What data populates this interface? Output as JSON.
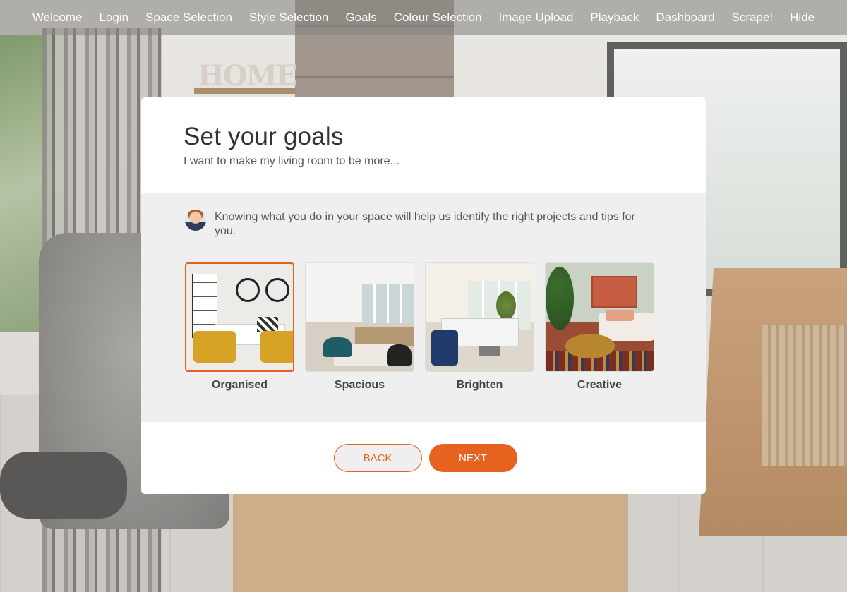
{
  "nav": {
    "items": [
      {
        "label": "Welcome"
      },
      {
        "label": "Login"
      },
      {
        "label": "Space Selection"
      },
      {
        "label": "Style Selection"
      },
      {
        "label": "Goals"
      },
      {
        "label": "Colour Selection"
      },
      {
        "label": "Image Upload"
      },
      {
        "label": "Playback"
      },
      {
        "label": "Dashboard"
      },
      {
        "label": "Scrape!"
      },
      {
        "label": "Hide"
      }
    ]
  },
  "modal": {
    "title": "Set your goals",
    "subtitle": "I want to make my living room to be more...",
    "advisor_text": "Knowing what you do in your space will help us identify the right projects and tips for you.",
    "goals": [
      {
        "label": "Organised",
        "selected": true
      },
      {
        "label": "Spacious",
        "selected": false
      },
      {
        "label": "Brighten",
        "selected": false
      },
      {
        "label": "Creative",
        "selected": false
      }
    ],
    "back_label": "BACK",
    "next_label": "NEXT"
  },
  "colors": {
    "accent": "#e6621e",
    "nav_bg": "rgba(130,128,125,0.55)",
    "body_gray": "#efefef"
  },
  "icons": {
    "advisor": "advisor-avatar"
  }
}
